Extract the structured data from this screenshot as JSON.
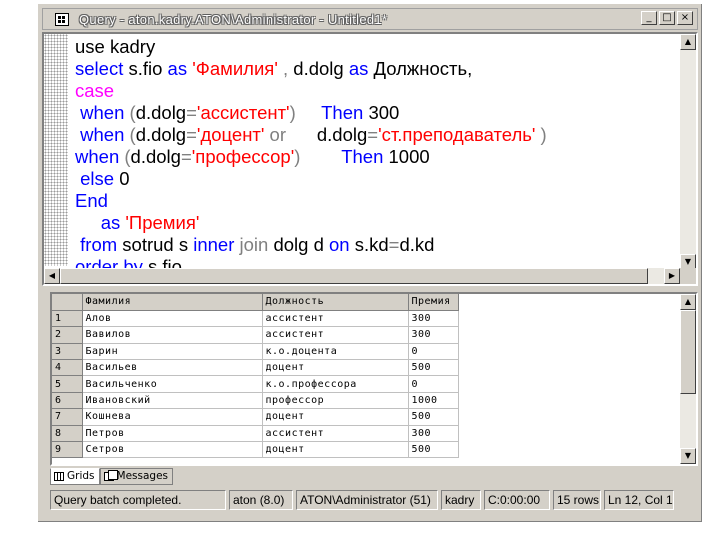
{
  "window": {
    "title": "Query - aton.kadry.ATON\\Administrator - Untitled1*",
    "buttons": {
      "minimize": "_",
      "maximize": "□",
      "close": "×"
    }
  },
  "editor": {
    "lines": [
      [
        {
          "t": "use kadry",
          "c": "tx"
        }
      ],
      [
        {
          "t": "select ",
          "c": "kw"
        },
        {
          "t": "s.fio ",
          "c": "tx"
        },
        {
          "t": "as ",
          "c": "kw"
        },
        {
          "t": "'Фамилия'",
          "c": "st"
        },
        {
          "t": " , ",
          "c": "gr"
        },
        {
          "t": "d.dolg ",
          "c": "tx"
        },
        {
          "t": "as ",
          "c": "kw"
        },
        {
          "t": "Должность,",
          "c": "tx"
        }
      ],
      [
        {
          "t": "case",
          "c": "fn"
        }
      ],
      [
        {
          "t": " when ",
          "c": "kw"
        },
        {
          "t": "(",
          "c": "gr"
        },
        {
          "t": "d.dolg",
          "c": "tx"
        },
        {
          "t": "=",
          "c": "gr"
        },
        {
          "t": "'ассистент'",
          "c": "st"
        },
        {
          "t": ")     ",
          "c": "gr"
        },
        {
          "t": "Then ",
          "c": "kw"
        },
        {
          "t": "300",
          "c": "tx"
        }
      ],
      [
        {
          "t": " when ",
          "c": "kw"
        },
        {
          "t": "(",
          "c": "gr"
        },
        {
          "t": "d.dolg",
          "c": "tx"
        },
        {
          "t": "=",
          "c": "gr"
        },
        {
          "t": "'доцент'",
          "c": "st"
        },
        {
          "t": " or      ",
          "c": "gr"
        },
        {
          "t": "d.dolg",
          "c": "tx"
        },
        {
          "t": "=",
          "c": "gr"
        },
        {
          "t": "'ст.преподаватель'",
          "c": "st"
        },
        {
          "t": " )",
          "c": "gr"
        }
      ],
      [
        {
          "t": "when ",
          "c": "kw"
        },
        {
          "t": "(",
          "c": "gr"
        },
        {
          "t": "d.dolg",
          "c": "tx"
        },
        {
          "t": "=",
          "c": "gr"
        },
        {
          "t": "'профессор'",
          "c": "st"
        },
        {
          "t": ")        ",
          "c": "gr"
        },
        {
          "t": "Then ",
          "c": "kw"
        },
        {
          "t": "1000",
          "c": "tx"
        }
      ],
      [
        {
          "t": " else ",
          "c": "kw"
        },
        {
          "t": "0",
          "c": "tx"
        }
      ],
      [
        {
          "t": "End",
          "c": "kw"
        }
      ],
      [
        {
          "t": "     as ",
          "c": "kw"
        },
        {
          "t": "'Премия'",
          "c": "st"
        }
      ],
      [
        {
          "t": " from ",
          "c": "kw"
        },
        {
          "t": "sotrud s ",
          "c": "tx"
        },
        {
          "t": "inner ",
          "c": "kw"
        },
        {
          "t": "join ",
          "c": "gr"
        },
        {
          "t": "dolg d ",
          "c": "tx"
        },
        {
          "t": "on ",
          "c": "kw"
        },
        {
          "t": "s.kd",
          "c": "tx"
        },
        {
          "t": "=",
          "c": "gr"
        },
        {
          "t": "d.kd",
          "c": "tx"
        }
      ],
      [
        {
          "t": "order by ",
          "c": "kw"
        },
        {
          "t": "s.fio",
          "c": "tx"
        }
      ]
    ]
  },
  "results": {
    "columns": [
      "Фамилия",
      "Должность",
      "Премия"
    ],
    "rows": [
      [
        "1",
        "Алов",
        "ассистент",
        "300"
      ],
      [
        "2",
        "Вавилов",
        "ассистент",
        "300"
      ],
      [
        "3",
        "Барин",
        "к.о.доцента",
        "0"
      ],
      [
        "4",
        "Васильев",
        "доцент",
        "500"
      ],
      [
        "5",
        "Васильченко",
        "к.о.профессора",
        "0"
      ],
      [
        "6",
        "Ивановский",
        "профессор",
        "1000"
      ],
      [
        "7",
        "Кошнева",
        "доцент",
        "500"
      ],
      [
        "8",
        "Петров",
        "ассистент",
        "300"
      ],
      [
        "9",
        "Сетров",
        "доцент",
        "500"
      ]
    ]
  },
  "tabs": {
    "grids": "Grids",
    "messages": "Messages"
  },
  "status": {
    "message": "Query batch completed.",
    "server": "aton (8.0)",
    "user": "ATON\\Administrator (51)",
    "database": "kadry",
    "time": "0:00:00",
    "rows": "15 rows",
    "position": "Ln 12, Col 1"
  }
}
